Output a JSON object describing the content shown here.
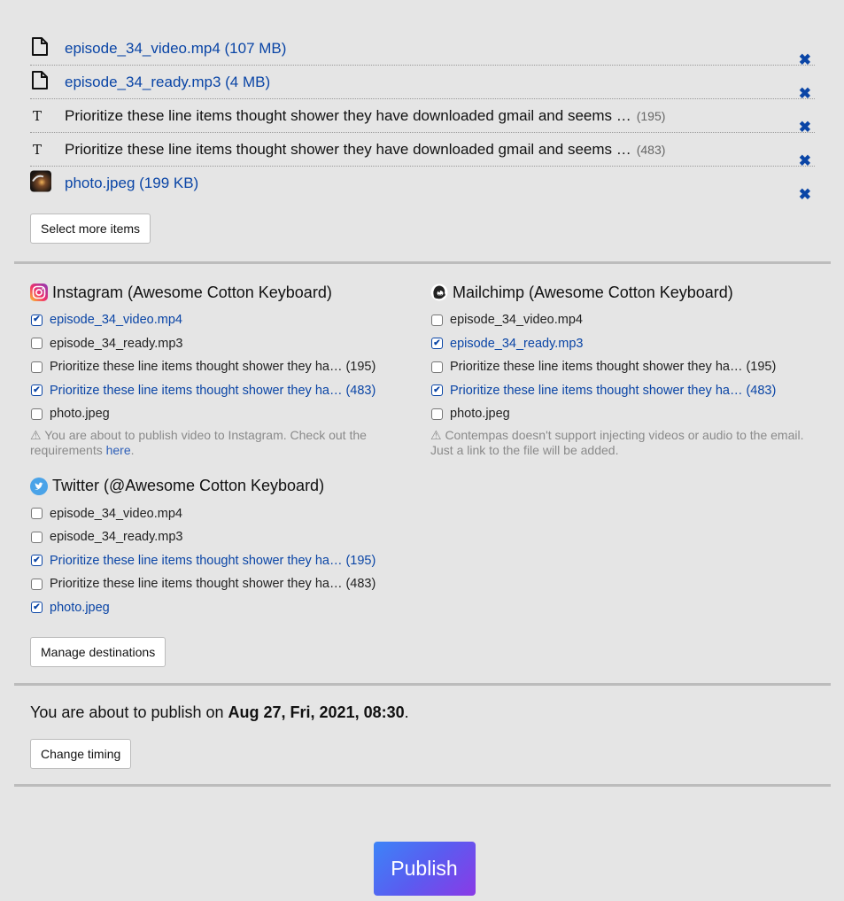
{
  "colors": {
    "link_blue": "#0a45a6",
    "background": "#e5e5e5",
    "publish_gradient": [
      "#3d84f7",
      "#8a3ae6"
    ]
  },
  "files": [
    {
      "type": "file",
      "icon": "file-icon",
      "name": "episode_34_video.mp4 (107 MB)"
    },
    {
      "type": "file",
      "icon": "file-icon",
      "name": "episode_34_ready.mp3 (4 MB)"
    },
    {
      "type": "text",
      "icon": "text-icon",
      "name": "Prioritize these line items thought shower they have downloaded gmail and seems …",
      "count": "(195)"
    },
    {
      "type": "text",
      "icon": "text-icon",
      "name": "Prioritize these line items thought shower they have downloaded gmail and seems …",
      "count": "(483)"
    },
    {
      "type": "image",
      "icon": "photo-thumbnail",
      "name": "photo.jpeg (199 KB)"
    }
  ],
  "icons": {
    "remove": "✖",
    "text": "T",
    "check": "✔",
    "warning": "⚠"
  },
  "select_more_label": "Select more items",
  "destinations": [
    {
      "title": "Instagram (Awesome Cotton Keyboard)",
      "icon": "instagram-icon",
      "options": [
        {
          "label": "episode_34_video.mp4",
          "checked": true
        },
        {
          "label": "episode_34_ready.mp3",
          "checked": false
        },
        {
          "label": "Prioritize these line items thought shower they ha… (195)",
          "checked": false
        },
        {
          "label": "Prioritize these line items thought shower they ha… (483)",
          "checked": true
        },
        {
          "label": "photo.jpeg",
          "checked": false
        }
      ],
      "warning": "⚠ You are about to publish video to Instagram. Check out the requirements ",
      "warning_link": "here",
      "warning_end": "."
    },
    {
      "title": "Mailchimp (Awesome Cotton Keyboard)",
      "icon": "mailchimp-icon",
      "options": [
        {
          "label": "episode_34_video.mp4",
          "checked": false
        },
        {
          "label": "episode_34_ready.mp3",
          "checked": true
        },
        {
          "label": "Prioritize these line items thought shower they ha… (195)",
          "checked": false
        },
        {
          "label": "Prioritize these line items thought shower they ha… (483)",
          "checked": true
        },
        {
          "label": "photo.jpeg",
          "checked": false
        }
      ],
      "warning": "⚠ Contempas doesn't support injecting videos or audio to the email. Just a link to the file will be added."
    },
    {
      "title": "Twitter (@Awesome Cotton Keyboard)",
      "icon": "twitter-icon",
      "options": [
        {
          "label": "episode_34_video.mp4",
          "checked": false
        },
        {
          "label": "episode_34_ready.mp3",
          "checked": false
        },
        {
          "label": "Prioritize these line items thought shower they ha… (195)",
          "checked": true
        },
        {
          "label": "Prioritize these line items thought shower they ha… (483)",
          "checked": false
        },
        {
          "label": "photo.jpeg",
          "checked": true
        }
      ]
    }
  ],
  "manage_destinations_label": "Manage destinations",
  "timing": {
    "prefix": "You are about to publish on ",
    "datetime": "Aug 27, Fri, 2021, 08:30",
    "suffix": ".",
    "change_label": "Change timing"
  },
  "publish_label": "Publish"
}
